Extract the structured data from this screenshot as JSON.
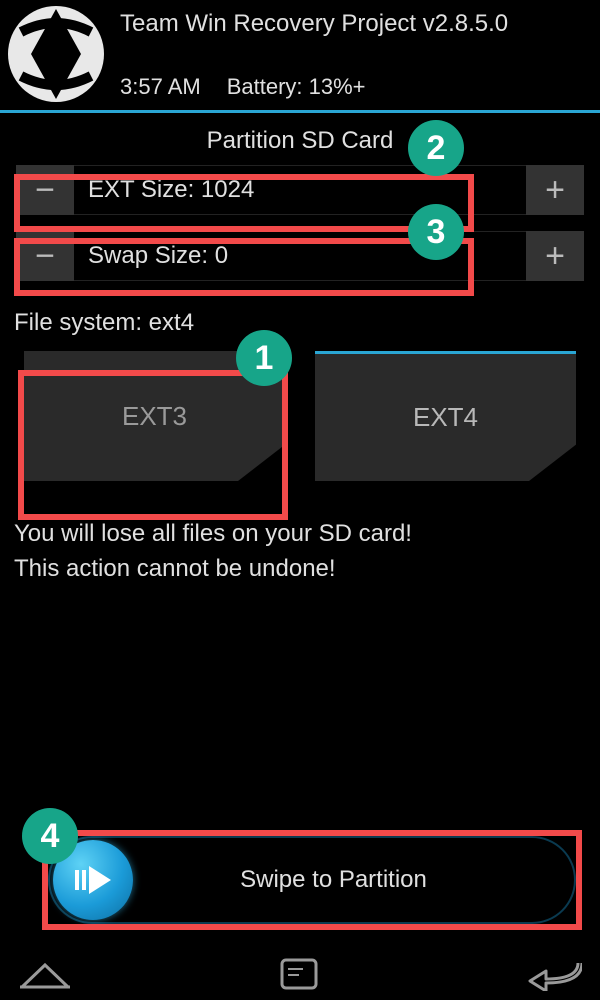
{
  "header": {
    "title": "Team Win Recovery Project  v2.8.5.0",
    "time": "3:57 AM",
    "battery": "Battery: 13%+"
  },
  "screen_title": "Partition SD Card",
  "steppers": {
    "ext": {
      "label": "EXT Size: 1024"
    },
    "swap": {
      "label": "Swap Size: 0"
    }
  },
  "filesystem": {
    "label": "File system: ext4",
    "options": [
      "EXT3",
      "EXT4"
    ],
    "selected": "ext4"
  },
  "warning": {
    "line1": "You will lose all files on your SD card!",
    "line2": "This action cannot be undone!"
  },
  "swipe": {
    "label": "Swipe to Partition"
  },
  "annotations": {
    "a1": "1",
    "a2": "2",
    "a3": "3",
    "a4": "4"
  }
}
